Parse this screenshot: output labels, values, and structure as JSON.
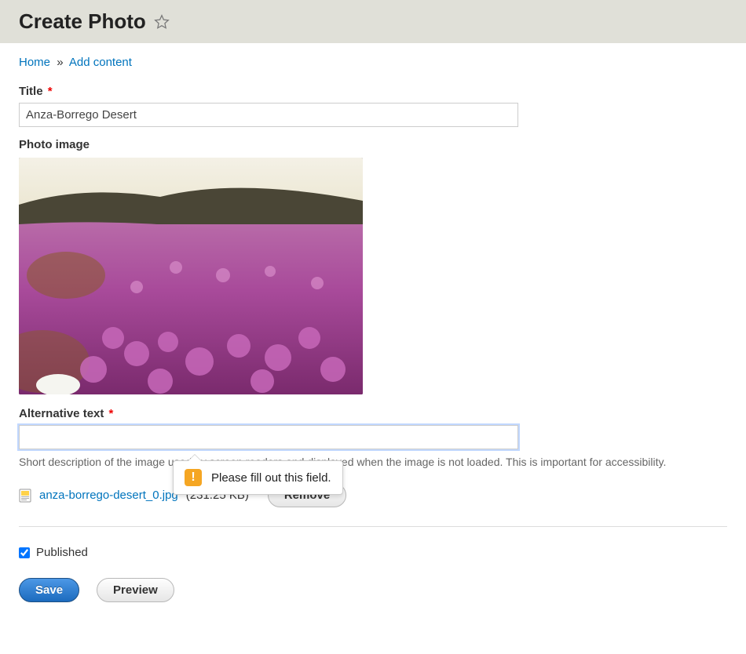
{
  "header": {
    "title": "Create Photo"
  },
  "breadcrumb": {
    "home": "Home",
    "separator": "»",
    "add_content": "Add content"
  },
  "form": {
    "title_label": "Title",
    "title_value": "Anza-Borrego Desert",
    "photo_label": "Photo image",
    "alt_label": "Alternative text",
    "alt_value": "",
    "alt_description": "Short description of the image used by screen readers and displayed when the image is not loaded. This is important for accessibility.",
    "file": {
      "name": "anza-borrego-desert_0.jpg",
      "size": "(231.25 KB)"
    },
    "remove_label": "Remove",
    "published_label": "Published",
    "published_checked": true
  },
  "validation": {
    "message": "Please fill out this field."
  },
  "actions": {
    "save": "Save",
    "preview": "Preview"
  }
}
